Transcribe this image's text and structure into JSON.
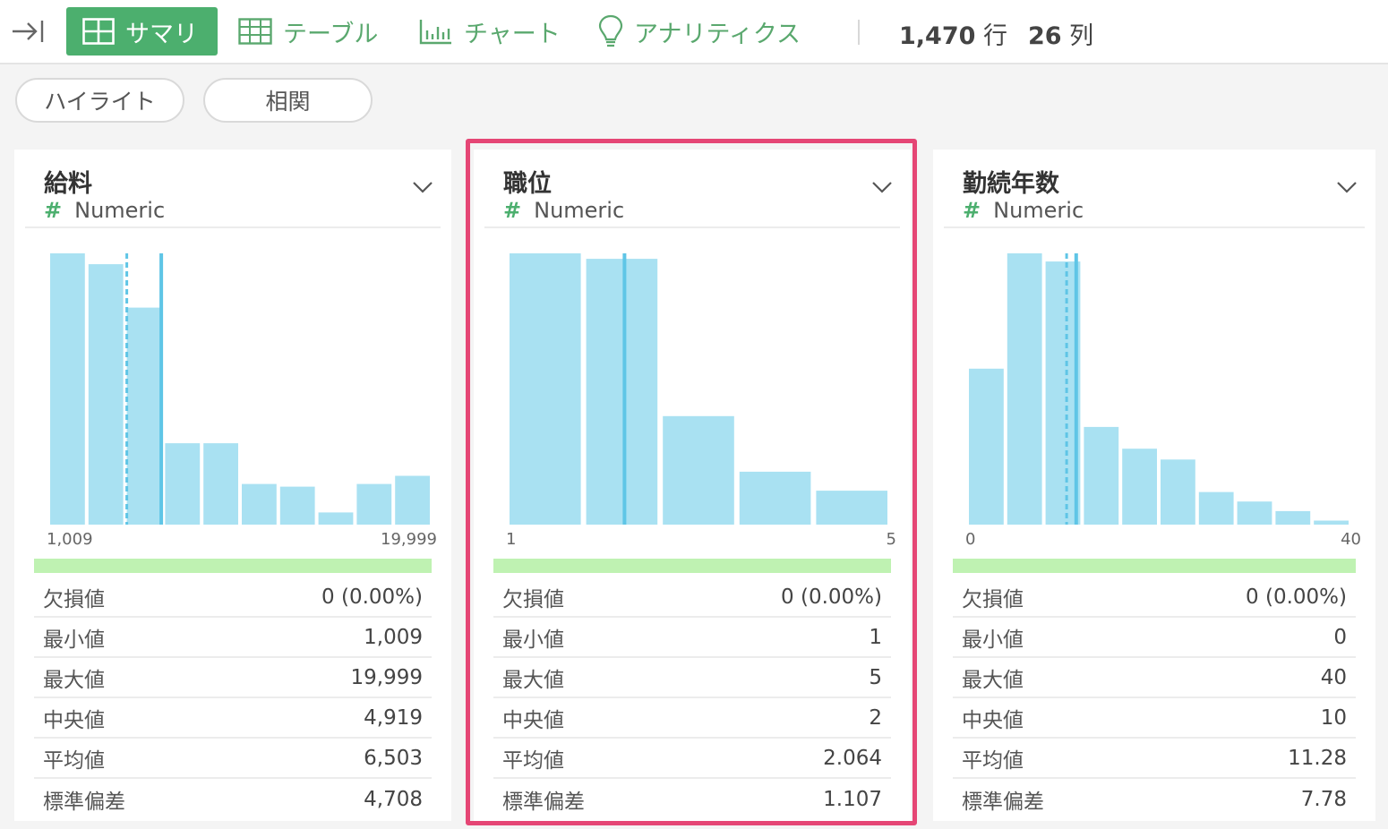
{
  "toolbar": {
    "tabs": [
      {
        "label": "サマリ",
        "icon": "summary-grid-icon",
        "active": true
      },
      {
        "label": "テーブル",
        "icon": "table-icon",
        "active": false
      },
      {
        "label": "チャート",
        "icon": "bar-chart-icon",
        "active": false
      },
      {
        "label": "アナリティクス",
        "icon": "lightbulb-icon",
        "active": false
      }
    ],
    "row_count": "1,470",
    "row_unit": "行",
    "col_count": "26",
    "col_unit": "列",
    "collapse_icon": "collapse-arrow-icon",
    "accent_color": "#4caf6e"
  },
  "filters": {
    "highlight_label": "ハイライト",
    "correlation_label": "相関"
  },
  "bar_color": "#a9e1f2",
  "mean_line_color": "#5fc5e6",
  "quality_color": "#bff2b2",
  "selection_color": "#e54675",
  "columns": [
    {
      "name": "給料",
      "type_symbol": "#",
      "type": "Numeric",
      "axis_min": "1,009",
      "axis_max": "19,999",
      "histogram": [
        1.0,
        0.96,
        0.8,
        0.3,
        0.3,
        0.15,
        0.14,
        0.045,
        0.15,
        0.18
      ],
      "median_position": 0.2,
      "mean_position": 0.29,
      "stats": [
        {
          "label": "欠損値",
          "value": "0 (0.00%)"
        },
        {
          "label": "最小値",
          "value": "1,009"
        },
        {
          "label": "最大値",
          "value": "19,999"
        },
        {
          "label": "中央値",
          "value": "4,919"
        },
        {
          "label": "平均値",
          "value": "6,503"
        },
        {
          "label": "標準偏差",
          "value": "4,708"
        }
      ]
    },
    {
      "name": "職位",
      "type_symbol": "#",
      "type": "Numeric",
      "axis_min": "1",
      "axis_max": "5",
      "histogram": [
        1.0,
        0.98,
        0.4,
        0.195,
        0.125
      ],
      "median_position": 0.3,
      "mean_position": 0.3,
      "stats": [
        {
          "label": "欠損値",
          "value": "0 (0.00%)"
        },
        {
          "label": "最小値",
          "value": "1"
        },
        {
          "label": "最大値",
          "value": "5"
        },
        {
          "label": "中央値",
          "value": "2"
        },
        {
          "label": "平均値",
          "value": "2.064"
        },
        {
          "label": "標準偏差",
          "value": "1.107"
        }
      ]
    },
    {
      "name": "勤続年数",
      "type_symbol": "#",
      "type": "Numeric",
      "axis_min": "0",
      "axis_max": "40",
      "histogram": [
        0.575,
        1.0,
        0.97,
        0.36,
        0.28,
        0.24,
        0.12,
        0.085,
        0.05,
        0.015
      ],
      "median_position": 0.255,
      "mean_position": 0.28,
      "stats": [
        {
          "label": "欠損値",
          "value": "0 (0.00%)"
        },
        {
          "label": "最小値",
          "value": "0"
        },
        {
          "label": "最大値",
          "value": "40"
        },
        {
          "label": "中央値",
          "value": "10"
        },
        {
          "label": "平均値",
          "value": "11.28"
        },
        {
          "label": "標準偏差",
          "value": "7.78"
        }
      ]
    }
  ]
}
